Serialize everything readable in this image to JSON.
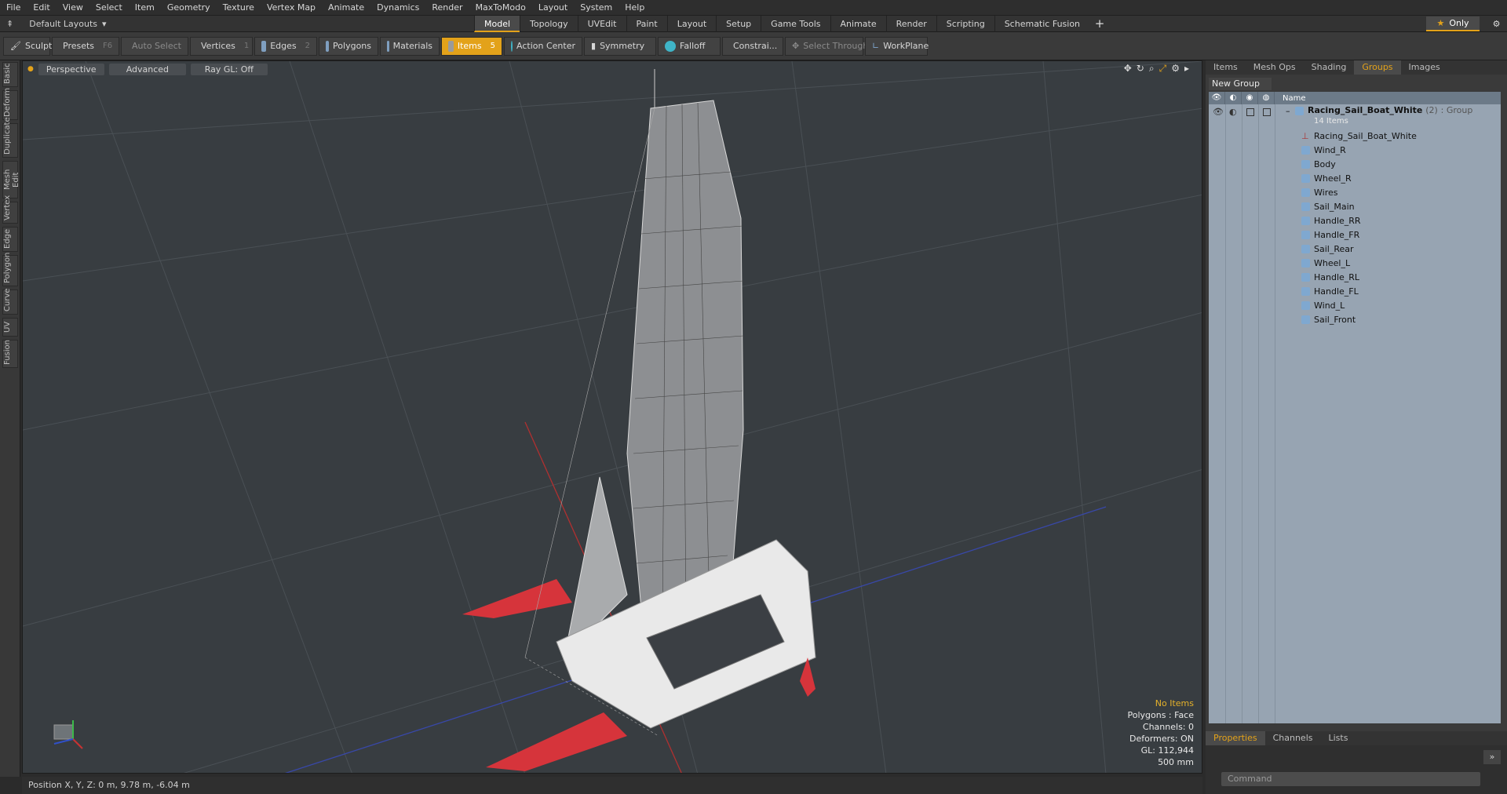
{
  "menu": [
    "File",
    "Edit",
    "View",
    "Select",
    "Item",
    "Geometry",
    "Texture",
    "Vertex Map",
    "Animate",
    "Dynamics",
    "Render",
    "MaxToModo",
    "Layout",
    "System",
    "Help"
  ],
  "layout_dropdown": "Default Layouts",
  "tabs": [
    "Model",
    "Topology",
    "UVEdit",
    "Paint",
    "Layout",
    "Setup",
    "Game Tools",
    "Animate",
    "Render",
    "Scripting",
    "Schematic Fusion"
  ],
  "active_tab": "Model",
  "only_label": "Only",
  "toolbar": {
    "sculpt": "Sculpt",
    "presets": "Presets",
    "presets_key": "F6",
    "auto_select": "Auto Select",
    "vertices": "Vertices",
    "vertices_key": "1",
    "edges": "Edges",
    "edges_key": "2",
    "polygons": "Polygons",
    "materials": "Materials",
    "items": "Items",
    "items_key": "5",
    "action_center": "Action Center",
    "symmetry": "Symmetry",
    "falloff": "Falloff",
    "constraints": "Constrai...",
    "select_through": "Select Through",
    "workplane": "WorkPlane"
  },
  "side_tabs": [
    "Basic",
    "Deform",
    "Duplicate",
    "Mesh Edit",
    "Vertex",
    "Edge",
    "Polygon",
    "Curve",
    "UV",
    "Fusion"
  ],
  "viewport": {
    "view": "Perspective",
    "mode": "Advanced",
    "raygl": "Ray GL: Off",
    "hud": {
      "items": "No Items",
      "polygons": "Polygons : Face",
      "channels": "Channels: 0",
      "deformers": "Deformers: ON",
      "gl": "GL: 112,944",
      "scale": "500 mm"
    }
  },
  "status": "Position X, Y, Z:  0 m, 9.78 m, -6.04 m",
  "right_tabs": [
    "Items",
    "Mesh Ops",
    "Shading",
    "Groups",
    "Images"
  ],
  "active_right_tab": "Groups",
  "new_group": "New Group",
  "group_header": "Name",
  "group_root": {
    "name": "Racing_Sail_Boat_White",
    "count": "(2)",
    "type": ": Group",
    "items": "14 Items"
  },
  "group_items": [
    "Racing_Sail_Boat_White",
    "Wind_R",
    "Body",
    "Wheel_R",
    "Wires",
    "Sail_Main",
    "Handle_RR",
    "Handle_FR",
    "Sail_Rear",
    "Wheel_L",
    "Handle_RL",
    "Handle_FL",
    "Wind_L",
    "Sail_Front"
  ],
  "bottom_tabs": [
    "Properties",
    "Channels",
    "Lists"
  ],
  "command_placeholder": "Command",
  "colors": {
    "accent": "#e3a21a",
    "viewport_bg": "#383d41",
    "hull_red": "#d6343b"
  }
}
